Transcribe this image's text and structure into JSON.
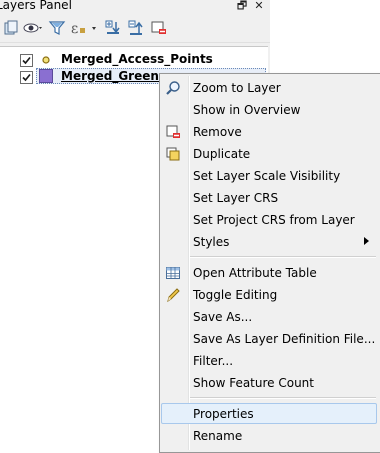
{
  "panel": {
    "title": "Layers Panel",
    "float_button": "🗗",
    "close_button": "✕",
    "layers": [
      {
        "name": "Merged_Access_Points",
        "checked": true
      },
      {
        "name": "Merged_Greensp",
        "checked": true
      }
    ]
  },
  "menu": {
    "items": [
      {
        "label": "Zoom to Layer",
        "icon": "zoom-icon"
      },
      {
        "label": "Show in Overview"
      },
      {
        "label": "Remove",
        "icon": "remove-layer-icon"
      },
      {
        "label": "Duplicate",
        "icon": "duplicate-layer-icon"
      },
      {
        "label": "Set Layer Scale Visibility"
      },
      {
        "label": "Set Layer CRS"
      },
      {
        "label": "Set Project CRS from Layer"
      },
      {
        "label": "Styles",
        "submenu": true
      },
      {
        "label": "Open Attribute Table",
        "icon": "attribute-table-icon"
      },
      {
        "label": "Toggle Editing",
        "icon": "pencil-icon"
      },
      {
        "label": "Save As..."
      },
      {
        "label": "Save As Layer Definition File..."
      },
      {
        "label": "Filter..."
      },
      {
        "label": "Show Feature Count"
      },
      {
        "label": "Properties",
        "highlighted": true
      },
      {
        "label": "Rename"
      }
    ]
  },
  "colors": {
    "menu_bg": "#f0f0f0",
    "highlight_bg": "#e5f0fb",
    "highlight_border": "#a8c8ec",
    "polygon_fill": "#8a6fd1",
    "point_symbol": "#b89a2a"
  }
}
